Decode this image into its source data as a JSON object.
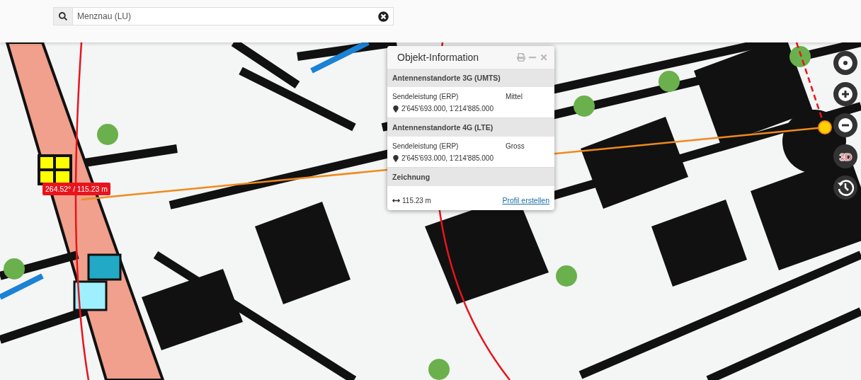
{
  "search": {
    "value": "Menznau (LU)"
  },
  "popup": {
    "title": "Objekt-Information",
    "sections": [
      {
        "kind": "feature",
        "title": "Antennenstandorte 3G (UMTS)",
        "label": "Sendeleistung (ERP)",
        "value": "Mittel",
        "coordinates": "2'645'693.000, 1'214'885.000"
      },
      {
        "kind": "feature",
        "title": "Antennenstandorte 4G (LTE)",
        "label": "Sendeleistung (ERP)",
        "value": "Gross",
        "coordinates": "2'645'693.000, 1'214'885.000"
      },
      {
        "kind": "drawing",
        "title": "Zeichnung",
        "distance": "115.23 m",
        "link": "Profil erstellen"
      }
    ]
  },
  "measurement": {
    "label": "264.52° / 115.23 m"
  },
  "map_controls": [
    {
      "kind": "locate"
    },
    {
      "kind": "zoom-in"
    },
    {
      "kind": "zoom-out"
    },
    {
      "kind": "perspective",
      "label": "3D"
    },
    {
      "kind": "history"
    }
  ]
}
